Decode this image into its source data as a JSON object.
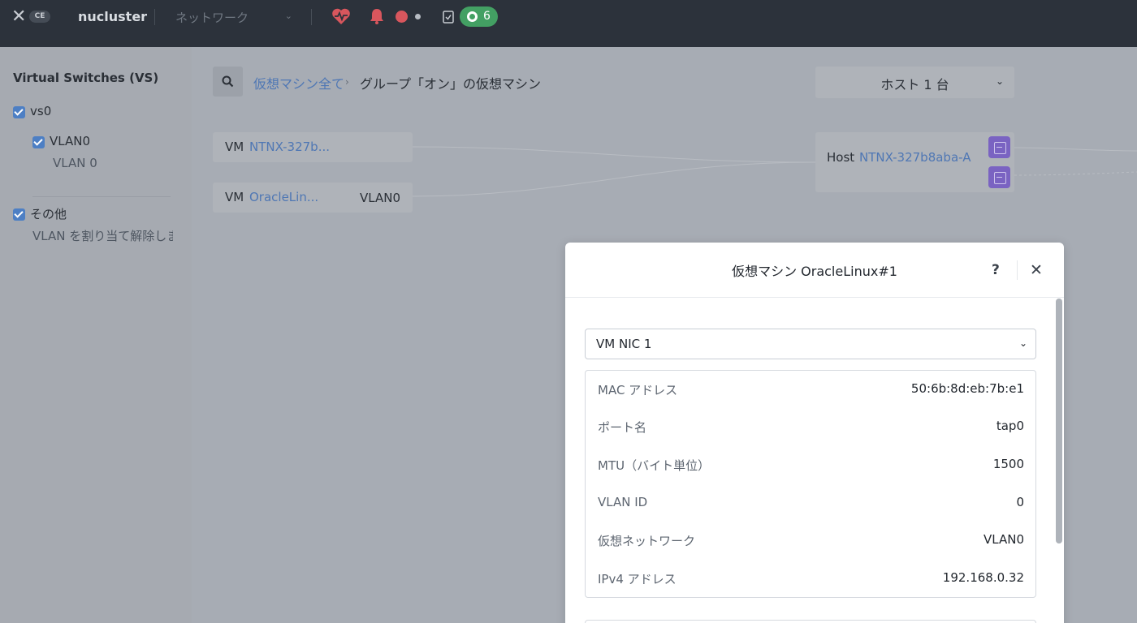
{
  "header": {
    "logo_text": "CE",
    "cluster_name": "nucluster",
    "nav_dropdown": "ネットワーク",
    "task_count": "6"
  },
  "sidebar": {
    "title": "Virtual Switches (VS)",
    "items": [
      {
        "label": "vs0",
        "checked": true
      },
      {
        "label": "VLAN0",
        "sub": "VLAN 0",
        "checked": true
      },
      {
        "label": "その他",
        "sub": "VLAN を割り当て解除しま",
        "checked": true
      }
    ]
  },
  "main": {
    "breadcrumb_link": "仮想マシン全て",
    "breadcrumb_current": "グループ「オン」の仮想マシン",
    "host_dropdown": "ホスト 1 台",
    "vms": [
      {
        "prefix": "VM",
        "name": "NTNX-327b...",
        "vlan": ""
      },
      {
        "prefix": "VM",
        "name": "OracleLin...",
        "vlan": "VLAN0"
      }
    ],
    "host": {
      "prefix": "Host",
      "name": "NTNX-327b8aba-A"
    }
  },
  "modal": {
    "title": "仮想マシン OracleLinux#1",
    "help_label": "?",
    "close_label": "✕",
    "nic_select": "VM NIC 1",
    "properties": [
      {
        "key": "MAC アドレス",
        "value": "50:6b:8d:eb:7b:e1"
      },
      {
        "key": "ポート名",
        "value": "tap0"
      },
      {
        "key": "MTU（バイト単位）",
        "value": "1500"
      },
      {
        "key": "VLAN ID",
        "value": "0"
      },
      {
        "key": "仮想ネットワーク",
        "value": "VLAN0"
      },
      {
        "key": "IPv4 アドレス",
        "value": "192.168.0.32"
      }
    ]
  },
  "colors": {
    "topbar_bg": "#2c323b",
    "link": "#4f77b4",
    "status_green": "#43a063",
    "alert_red": "#d8565d",
    "port_purple": "#7a63c2"
  }
}
